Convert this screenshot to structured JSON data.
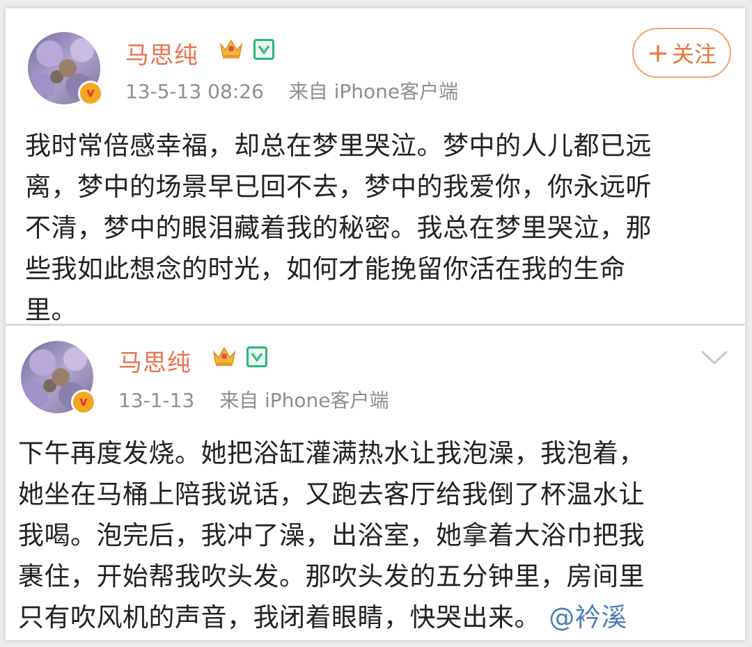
{
  "posts": [
    {
      "username": "马思纯",
      "timestamp": "13-5-13 08:26",
      "source": "来自 iPhone客户端",
      "follow_plus": "+",
      "follow_label": "关注",
      "verified_mark": "v",
      "lines": [
        "我时常倍感幸福，却总在梦里哭泣。梦中的人儿都已远",
        "离，梦中的场景早已回不去，梦中的我爱你，你永远听",
        "不清，梦中的眼泪藏着我的秘密。我总在梦里哭泣，那",
        "些我如此想念的时光，如何才能挽留你活在我的生命",
        "里。"
      ]
    },
    {
      "username": "马思纯",
      "timestamp": "13-1-13",
      "source": "来自 iPhone客户端",
      "verified_mark": "v",
      "lines": [
        "下午再度发烧。她把浴缸灌满热水让我泡澡，我泡着，",
        "她坐在马桶上陪我说话，又跑去客厅给我倒了杯温水让",
        "我喝。泡完后，我冲了澡，出浴室，她拿着大浴巾把我",
        "裹住，开始帮我吹头发。那吹头发的五分钟里，房间里",
        "只有吹风机的声音，我闭着眼睛，快哭出来。"
      ],
      "mention": "@衿溪"
    }
  ],
  "colors": {
    "username": "#eb7350",
    "meta": "#8e8e8e",
    "body": "#222222",
    "mention": "#4e7db9",
    "follow_border": "#f2a36e",
    "vip_green": "#2bb673",
    "verified_badge": "#f5a623"
  },
  "icons": [
    "avatar",
    "verified-badge-icon",
    "crown-icon",
    "vip-icon",
    "chevron-down-icon"
  ]
}
